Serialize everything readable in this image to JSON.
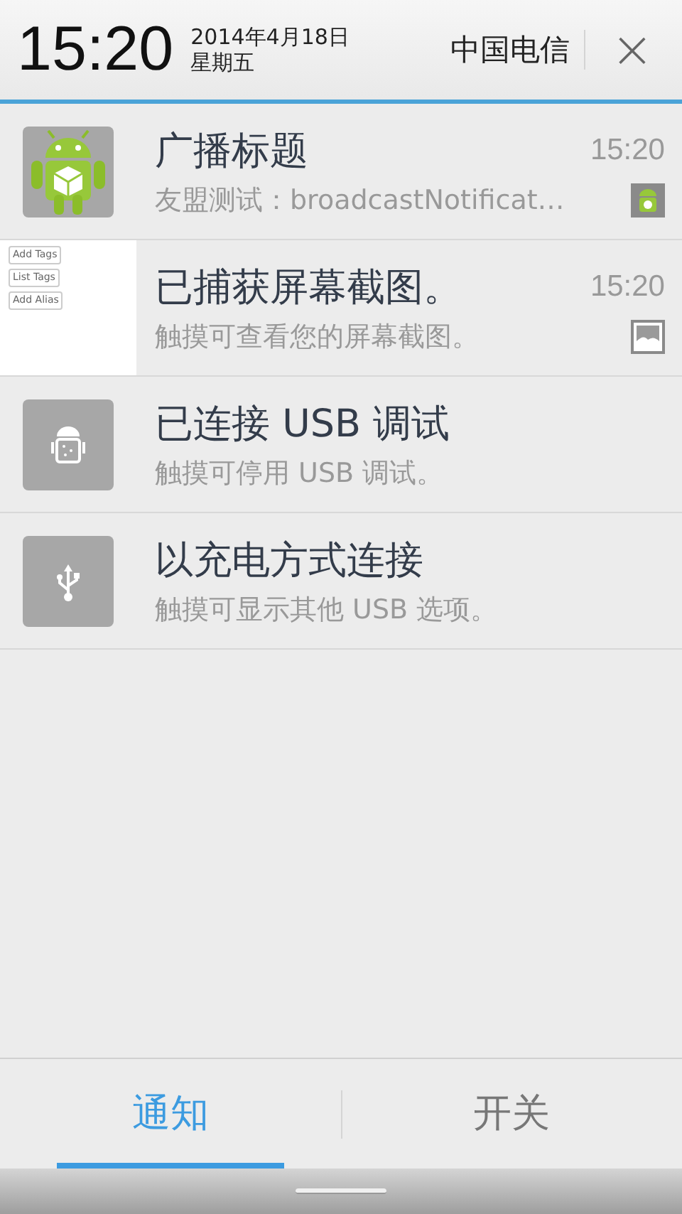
{
  "header": {
    "time": "15:20",
    "date": "2014年4月18日",
    "weekday": "星期五",
    "carrier": "中国电信",
    "close": "×"
  },
  "notifications": [
    {
      "kind": "app",
      "title": "广播标题",
      "time": "15:20",
      "text": "友盟测试：broadcastNotificat…",
      "small_icon": true
    },
    {
      "kind": "screenshot",
      "title": "已捕获屏幕截图。",
      "time": "15:20",
      "text": "触摸可查看您的屏幕截图。",
      "small_icon": true,
      "thumbnail": [
        "Add Tags",
        "List Tags",
        "Add Alias"
      ]
    },
    {
      "kind": "debug",
      "title": "已连接 USB 调试",
      "text": "触摸可停用 USB 调试。"
    },
    {
      "kind": "usb",
      "title": "以充电方式连接",
      "text": "触摸可显示其他 USB 选项。"
    }
  ],
  "tabs": [
    {
      "label": "通知",
      "selected": true
    },
    {
      "label": "开关",
      "selected": false
    }
  ]
}
